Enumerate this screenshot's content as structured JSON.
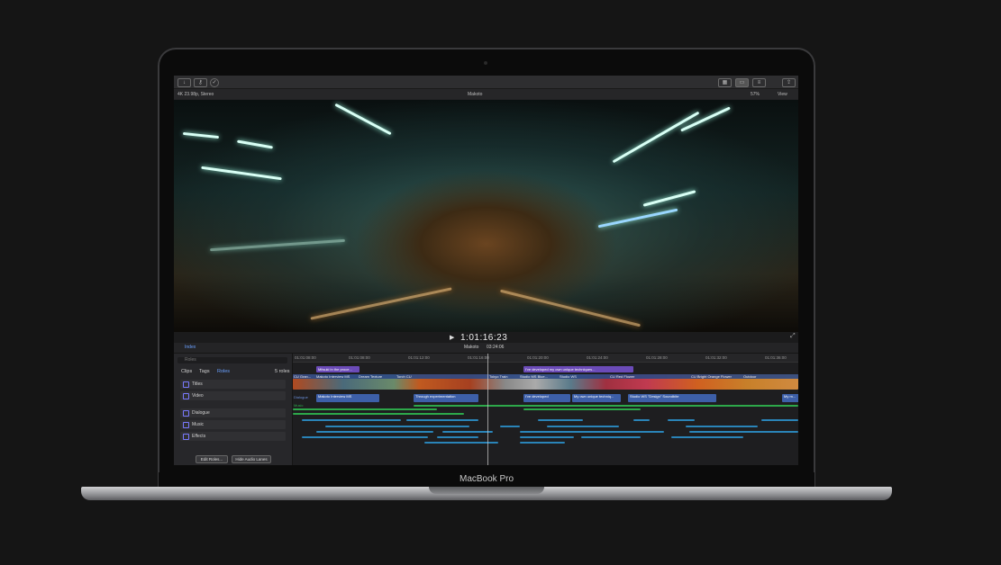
{
  "device": {
    "brand_label": "MacBook Pro"
  },
  "toolbar": {
    "import_icon": "download-icon",
    "keywords_icon": "key-icon",
    "analyze_icon": "check-icon",
    "browser_toggle": "grid-icon",
    "viewer_toggle": "viewer-icon",
    "inspector_toggle": "inspector-icon",
    "share_icon": "share-icon"
  },
  "viewer_info": {
    "format": "4K 23.98p, Stereo",
    "project": "Makoto",
    "zoom": "57%",
    "view_menu": "View"
  },
  "playback": {
    "timecode": "1:01:16:23"
  },
  "timeline_header": {
    "index_tab": "Index",
    "project_name": "Makoto",
    "duration": "03:24:06"
  },
  "sidebar": {
    "search_placeholder": "Roles",
    "tabs": [
      {
        "label": "Clips"
      },
      {
        "label": "Tags"
      },
      {
        "label": "Roles"
      }
    ],
    "count": "5 roles",
    "roles": [
      {
        "label": "Titles"
      },
      {
        "label": "Video"
      },
      {
        "label": "Dialogue"
      },
      {
        "label": "Music"
      },
      {
        "label": "Effects"
      }
    ],
    "edit_roles_button": "Edit Roles...",
    "hide_audio_button": "Hide Audio Lanes"
  },
  "ruler": [
    "01:01:08:00",
    "01:01:08:00",
    "01:01:12:00",
    "01:01:16:00",
    "01:01:20:00",
    "01:01:24:00",
    "01:01:28:00",
    "01:01:32:00",
    "01:01:36:00",
    "01:01:40:00"
  ],
  "titles": [
    {
      "text": "Mitsuki in the proce..."
    },
    {
      "text": "I've developed my own unique techniques..."
    }
  ],
  "video_clips": [
    {
      "label": "CU Gran..."
    },
    {
      "label": "Makoto Interview MS"
    },
    {
      "label": "Dream Texture"
    },
    {
      "label": "Torch CU"
    },
    {
      "label": "Tokyo Train"
    },
    {
      "label": "Studio MS Blue..."
    },
    {
      "label": "Studio WS"
    },
    {
      "label": "CU Red Flower"
    },
    {
      "label": "CU Bright Orange Flower"
    },
    {
      "label": "Outdoor"
    }
  ],
  "dialogue_clips": [
    {
      "label": "Makoto Interview MS"
    },
    {
      "label": "Through experimentation"
    },
    {
      "label": "I've developed"
    },
    {
      "label": "My own unique techniq..."
    },
    {
      "label": "Studio WS \"Design\" Soundbite"
    },
    {
      "label": "My m..."
    }
  ],
  "lane_labels": {
    "dialogue": "Dialogue",
    "music": "Music"
  },
  "colors": {
    "title": "#6b4bb8",
    "video": "#3a5a9a",
    "dialogue": "#4a6fc0",
    "music": "#2da84a",
    "effects": "#2a84b8",
    "accent": "#4c8dff"
  }
}
